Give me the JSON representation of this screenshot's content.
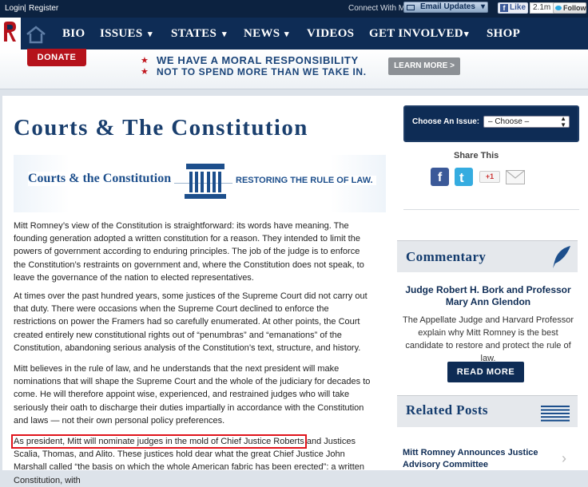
{
  "topbar": {
    "login": "Login",
    "sep": "|",
    "register": "Register",
    "connect": "Connect With Mitt",
    "email_updates": "Email Updates",
    "like": "Like",
    "like_count": "2.1m",
    "follow": "Follow"
  },
  "nav": {
    "items": [
      "BIO",
      "ISSUES",
      "STATES",
      "NEWS",
      "VIDEOS",
      "GET INVOLVED",
      "SHOP"
    ],
    "dropdown_marker": "▾"
  },
  "banner": {
    "donate": "DONATE",
    "line1": "WE HAVE A MORAL RESPONSIBILITY",
    "line2": "NOT TO SPEND MORE THAN WE TAKE IN.",
    "learn_more": "LEARN MORE >"
  },
  "page": {
    "title": "Courts & The Constitution"
  },
  "hero": {
    "left": "Courts & the Constitution",
    "right": "RESTORING THE RULE OF LAW."
  },
  "body": {
    "p1": "Mitt Romney’s view of the Constitution is straightforward: its words have meaning. The founding generation adopted a written constitution for a reason. They intended to limit the powers of government according to enduring principles. The job of the judge is to enforce the Constitution’s restraints on government and, where the Constitution does not speak, to leave the governance of the nation to elected representatives.",
    "p2": "At times over the past hundred years, some justices of the Supreme Court did not carry out that duty. There were occasions when the Supreme Court declined to enforce the restrictions on power the Framers had so carefully enumerated. At other points, the Court created entirely new constitutional rights out of “penumbras” and “emanations” of the Constitution, abandoning serious analysis of the Constitution’s text, structure, and history.",
    "p3": "Mitt believes in the rule of law, and he understands that the next president will make nominations that will shape the Supreme Court and the whole of the judiciary for decades to come. He will therefore appoint wise, experienced, and restrained judges who will take seriously their oath to discharge their duties impartially in accordance with the Constitution and laws — not their own personal policy preferences.",
    "p4_highlight": "As president, Mitt will nominate judges in the mold of Chief Justice Roberts",
    "p4_rest": " and Justices Scalia, Thomas, and Alito. These justices hold dear what the great Chief Justice John Marshall called “the basis on which the whole American fabric has been erected”: a written Constitution, with"
  },
  "sidebar": {
    "choose_label": "Choose An Issue:",
    "choose_value": "– Choose –",
    "share_title": "Share This",
    "gplus": "+1",
    "commentary_title": "Commentary",
    "commentary_heading": "Judge Robert H. Bork and Professor Mary Ann Glendon",
    "commentary_text": "The Appellate Judge and Harvard Professor explain why Mitt Romney is the best candidate to restore and protect the rule of law.",
    "read_more": "READ MORE",
    "related_title": "Related Posts",
    "related_item": "Mitt Romney Announces Justice Advisory Committee"
  },
  "colors": {
    "navy": "#0e2c55",
    "red": "#b5121b",
    "title_blue": "#1a3f6e",
    "highlight": "#e0141c"
  }
}
